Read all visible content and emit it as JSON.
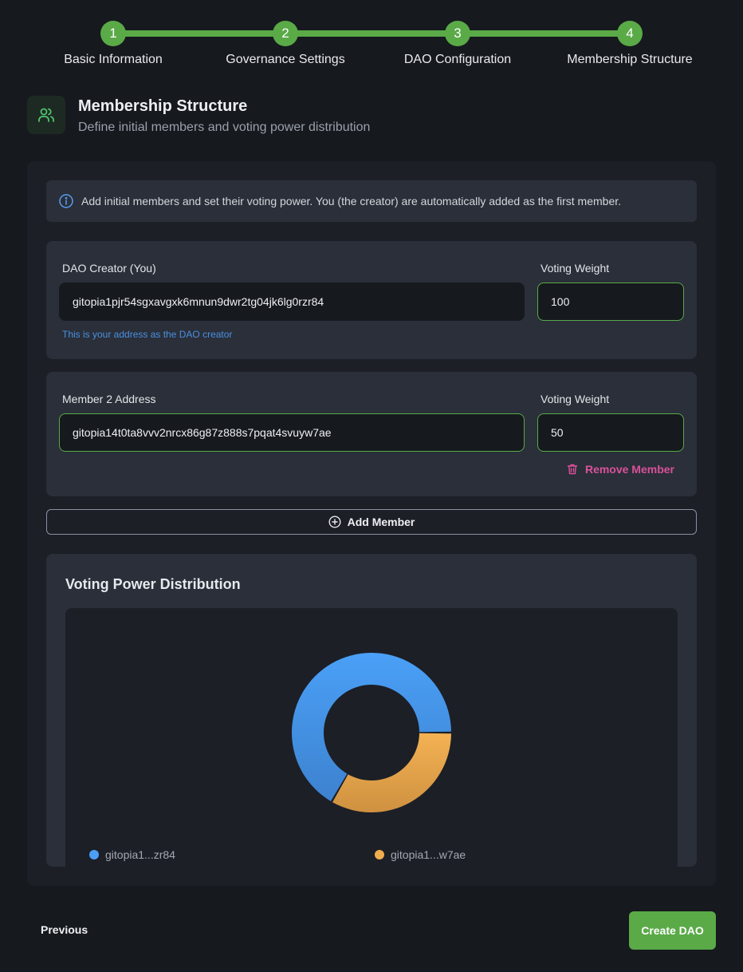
{
  "stepper": {
    "steps": [
      {
        "number": "1",
        "label": "Basic Information"
      },
      {
        "number": "2",
        "label": "Governance Settings"
      },
      {
        "number": "3",
        "label": "DAO Configuration"
      },
      {
        "number": "4",
        "label": "Membership Structure"
      }
    ],
    "current_step": 4,
    "accent_color": "#5aaa47"
  },
  "header": {
    "icon": "users-icon",
    "title": "Membership Structure",
    "subtitle": "Define initial members and voting power distribution"
  },
  "info": {
    "icon": "info-icon",
    "text": "Add initial members and set their voting power. You (the creator) are automatically added as the first member."
  },
  "members": [
    {
      "address_label": "DAO Creator (You)",
      "address": "gitopia1pjr54sgxavgxk6mnun9dwr2tg04jk6lg0rzr84",
      "weight_label": "Voting Weight",
      "weight": "100",
      "hint": "This is your address as the DAO creator"
    },
    {
      "address_label": "Member 2 Address",
      "address": "gitopia14t0ta8vvv2nrcx86g87z888s7pqat4svuyw7ae",
      "weight_label": "Voting Weight",
      "weight": "50",
      "remove_label": "Remove Member"
    }
  ],
  "add_member_label": "Add Member",
  "chart_data": {
    "type": "pie",
    "title": "Voting Power Distribution",
    "donut": true,
    "categories": [
      "gitopia1...zr84",
      "gitopia1...w7ae"
    ],
    "values": [
      100,
      50
    ],
    "colors": [
      "#4a9ff5",
      "#f0ad4e"
    ],
    "legend": "bottom"
  },
  "footer": {
    "previous_label": "Previous",
    "create_label": "Create DAO"
  }
}
